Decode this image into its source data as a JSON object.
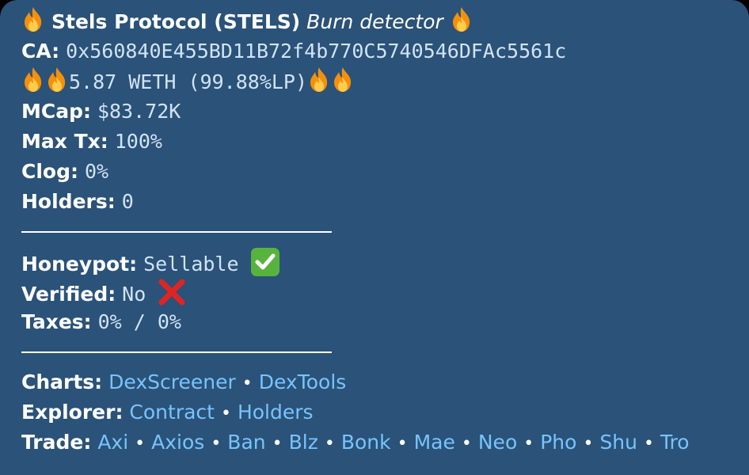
{
  "message": {
    "title_name": "Stels Protocol (STELS)",
    "title_tag": "Burn detector",
    "ca_label": "CA:",
    "ca_value": "0x560840E455BD11B72f4b770C5740546DFAc5561c",
    "liquidity": "5.87 WETH (99.88%LP)",
    "mcap_label": "MCap:",
    "mcap_value": "$83.72K",
    "maxtx_label": "Max Tx:",
    "maxtx_value": "100%",
    "clog_label": "Clog:",
    "clog_value": "0%",
    "holders_label": "Holders:",
    "holders_value": "0",
    "honeypot_label": "Honeypot:",
    "honeypot_value": "Sellable",
    "verified_label": "Verified:",
    "verified_value": "No",
    "taxes_label": "Taxes:",
    "taxes_value": "0% / 0%",
    "charts_label": "Charts:",
    "charts_links": [
      "DexScreener",
      "DexTools"
    ],
    "explorer_label": "Explorer:",
    "explorer_links": [
      "Contract",
      "Holders"
    ],
    "trade_label": "Trade:",
    "trade_links": [
      "Axi",
      "Axios",
      "Ban",
      "Blz",
      "Bonk",
      "Mae",
      "Neo",
      "Pho",
      "Shu",
      "Tro"
    ],
    "separator": "•"
  },
  "icons": {
    "fire": "fire-icon",
    "check": "check-mark-button-icon",
    "cross": "cross-mark-icon"
  },
  "colors": {
    "bubble": "#2b5278",
    "link": "#77c4ff",
    "mono_text": "#d1e3f5",
    "check_green": "#58b33e",
    "cross_red": "#e02424",
    "fire_orange": "#f4900c"
  }
}
